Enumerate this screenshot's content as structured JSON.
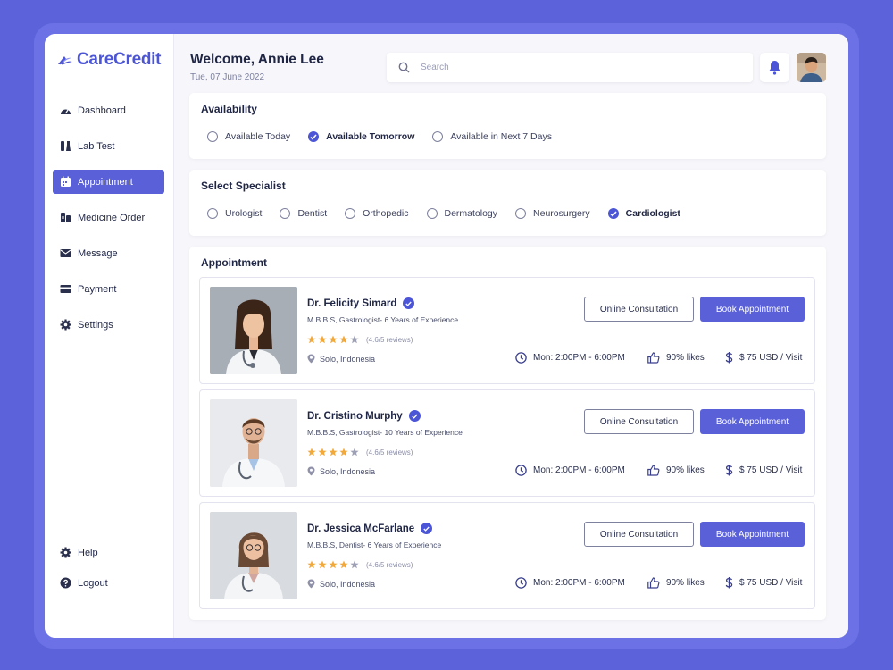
{
  "brand": {
    "name": "CareCredit",
    "accent": "#4b55d6"
  },
  "sidebar": {
    "items": [
      {
        "label": "Dashboard",
        "icon": "dashboard-icon"
      },
      {
        "label": "Lab Test",
        "icon": "lab-flask-icon"
      },
      {
        "label": "Appointment",
        "icon": "calendar-icon",
        "active": true
      },
      {
        "label": "Medicine Order",
        "icon": "pill-icon"
      },
      {
        "label": "Message",
        "icon": "envelope-icon"
      },
      {
        "label": "Payment",
        "icon": "card-icon"
      },
      {
        "label": "Settings",
        "icon": "gear-icon"
      }
    ],
    "bottom": [
      {
        "label": "Help",
        "icon": "help-gear-icon"
      },
      {
        "label": "Logout",
        "icon": "logout-icon"
      }
    ]
  },
  "header": {
    "welcome": "Welcome, Annie Lee",
    "date": "Tue, 07 June 2022",
    "search_placeholder": "Search"
  },
  "availability": {
    "title": "Availability",
    "options": [
      {
        "label": "Available Today",
        "checked": false
      },
      {
        "label": "Available Tomorrow",
        "checked": true
      },
      {
        "label": "Available in Next 7 Days",
        "checked": false
      }
    ]
  },
  "specialist": {
    "title": "Select Specialist",
    "options": [
      {
        "label": "Urologist",
        "checked": false
      },
      {
        "label": "Dentist",
        "checked": false
      },
      {
        "label": "Orthopedic",
        "checked": false
      },
      {
        "label": "Dermatology",
        "checked": false
      },
      {
        "label": "Neurosurgery",
        "checked": false
      },
      {
        "label": "Cardiologist",
        "checked": true
      }
    ]
  },
  "appointments": {
    "title": "Appointment",
    "online_label": "Online Consultation",
    "book_label": "Book Appointment",
    "doctors": [
      {
        "name": "Dr. Felicity Simard",
        "qualification": "M.B.B.S, Gastrologist- 6 Years of Experience",
        "stars": 4,
        "rating": "(4.6/5 reviews)",
        "location": "Solo, Indonesia",
        "schedule": "Mon: 2:00PM - 6:00PM",
        "likes": "90% likes",
        "price": "$ 75 USD / Visit"
      },
      {
        "name": "Dr. Cristino Murphy",
        "qualification": "M.B.B.S, Gastrologist- 10 Years of Experience",
        "stars": 4,
        "rating": "(4.6/5 reviews)",
        "location": "Solo, Indonesia",
        "schedule": "Mon: 2:00PM - 6:00PM",
        "likes": "90% likes",
        "price": "$ 75 USD / Visit"
      },
      {
        "name": "Dr. Jessica McFarlane",
        "qualification": "M.B.B.S, Dentist- 6 Years of Experience",
        "stars": 4,
        "rating": "(4.6/5 reviews)",
        "location": "Solo, Indonesia",
        "schedule": "Mon: 2:00PM - 6:00PM",
        "likes": "90% likes",
        "price": "$ 75 USD / Visit"
      }
    ]
  }
}
